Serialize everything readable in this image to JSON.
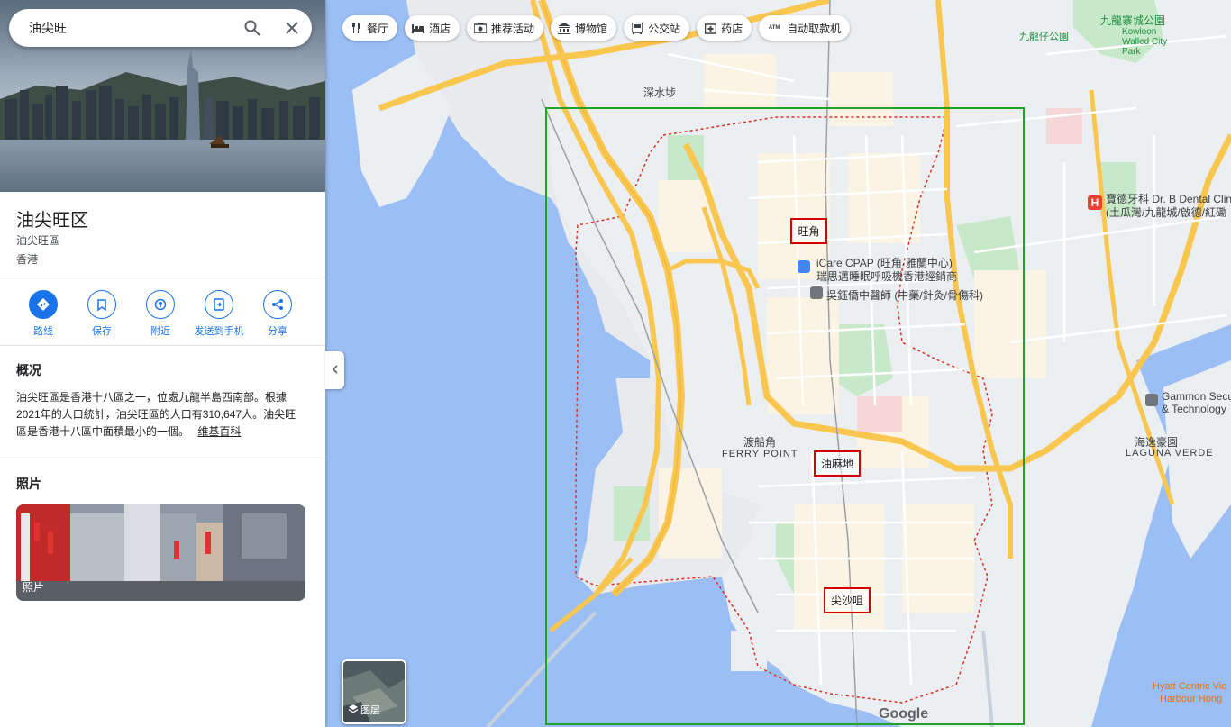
{
  "search": {
    "value": "油尖旺"
  },
  "place": {
    "title": "油尖旺区",
    "subtitle": "油尖旺區",
    "region": "香港"
  },
  "actions": [
    {
      "label": "路线",
      "icon": "directions-icon"
    },
    {
      "label": "保存",
      "icon": "bookmark-icon"
    },
    {
      "label": "附近",
      "icon": "nearby-icon"
    },
    {
      "label": "发送到手机",
      "icon": "send-to-phone-icon"
    },
    {
      "label": "分享",
      "icon": "share-icon"
    }
  ],
  "overview": {
    "heading": "概况",
    "text": "油尖旺區是香港十八區之一，位處九龍半島西南部。根據2021年的人口統計，油尖旺區的人口有310,647人。油尖旺區是香港十八區中面積最小的一個。",
    "link": "维基百科"
  },
  "photos": {
    "heading": "照片",
    "label": "照片"
  },
  "chips": [
    {
      "label": "餐厅",
      "icon": "restaurant-icon"
    },
    {
      "label": "酒店",
      "icon": "hotel-icon"
    },
    {
      "label": "推荐活动",
      "icon": "camera-icon"
    },
    {
      "label": "博物馆",
      "icon": "museum-icon"
    },
    {
      "label": "公交站",
      "icon": "bus-icon"
    },
    {
      "label": "药店",
      "icon": "pharmacy-icon"
    },
    {
      "label": "自动取款机",
      "icon": "atm-icon"
    }
  ],
  "map_labels": {
    "mongkok": "旺角",
    "yaumatei": "油麻地",
    "tst": "尖沙咀",
    "shamshuipo": "深水埗",
    "ferry_cn": "渡船角",
    "ferry_en": "FERRY POINT",
    "icare": "iCare CPAP (旺角·雅蘭中心)",
    "icare2": "瑞思邁睡眠呼吸機香港經銷商",
    "ng": "吳鈺僑中醫師 (中藥/針灸/骨傷科)",
    "kowloon_city": "九龍寨城公園",
    "kowloon_walled": "Kowloon Walled City Park",
    "dental": "寶德牙科 Dr. B Dental Clin",
    "dental2": "(土瓜灣/九龍城/啟德/紅磡",
    "gammon": "Gammon Secu",
    "gammon2": "& Technology",
    "laguna_cn": "海逸豪園",
    "laguna_en": "LAGUNA VERDE",
    "hyatt": "Hyatt Centric Vic",
    "hyatt2": "Harbour Hong",
    "kowloon_tsai": "九龍仔公園"
  },
  "layers": {
    "label": "图层"
  },
  "google": "Google"
}
